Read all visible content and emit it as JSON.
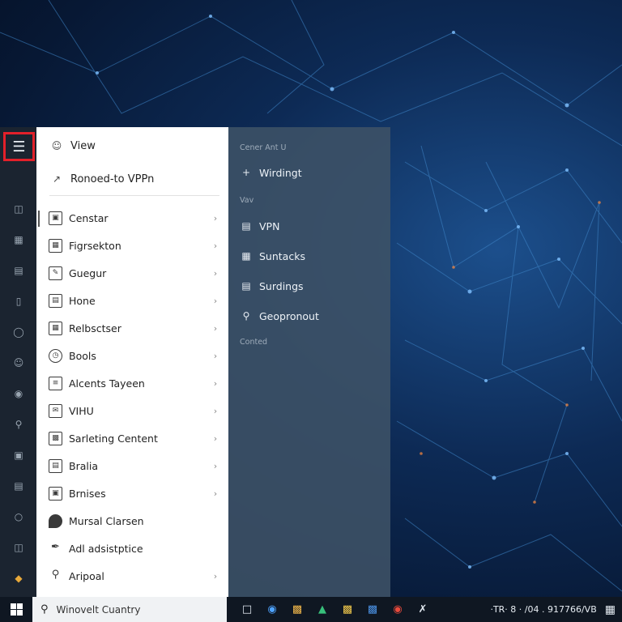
{
  "menu": {
    "top_items": [
      {
        "label": "View",
        "icon": "people-icon"
      },
      {
        "label": "Ronoed-to VPPn",
        "icon": "arrow-icon"
      }
    ],
    "items": [
      {
        "label": "Censtar",
        "icon": "monitor-icon",
        "chevron": true
      },
      {
        "label": "Figrsekton",
        "icon": "grid-icon",
        "chevron": true
      },
      {
        "label": "Guegur",
        "icon": "edit-icon",
        "chevron": true
      },
      {
        "label": "Hone",
        "icon": "document-icon",
        "chevron": true
      },
      {
        "label": "Relbsctser",
        "icon": "table-icon",
        "chevron": true
      },
      {
        "label": "Bools",
        "icon": "clock-icon",
        "chevron": true
      },
      {
        "label": "Alcents Tayeen",
        "icon": "list-icon",
        "chevron": true
      },
      {
        "label": "VIHU",
        "icon": "chat-icon",
        "chevron": true
      },
      {
        "label": "Sarleting Centent",
        "icon": "folder-icon",
        "chevron": true
      },
      {
        "label": "Bralia",
        "icon": "printer-icon",
        "chevron": true
      },
      {
        "label": "Brnises",
        "icon": "window-icon",
        "chevron": true
      },
      {
        "label": "Mursal Clarsen",
        "icon": "shield-icon",
        "chevron": false
      },
      {
        "label": "Adl adsistptice",
        "icon": "pen-icon",
        "chevron": false
      },
      {
        "label": "Aripoal",
        "icon": "location-icon",
        "chevron": true
      }
    ]
  },
  "submenu": {
    "headers": [
      "Cener Ant U",
      "Vav",
      "Conted"
    ],
    "items": [
      {
        "label": "Wirdingt",
        "icon": "plus-icon"
      },
      {
        "label": "VPN",
        "icon": "vpn-icon"
      },
      {
        "label": "Suntacks",
        "icon": "grid-icon"
      },
      {
        "label": "Surdings",
        "icon": "stack-icon"
      },
      {
        "label": "Geopronout",
        "icon": "pin-icon"
      }
    ]
  },
  "taskbar": {
    "search_text": "Winovelt Cuantry",
    "tray_text": "·TR· 8 · /04 . 917766/VB"
  }
}
